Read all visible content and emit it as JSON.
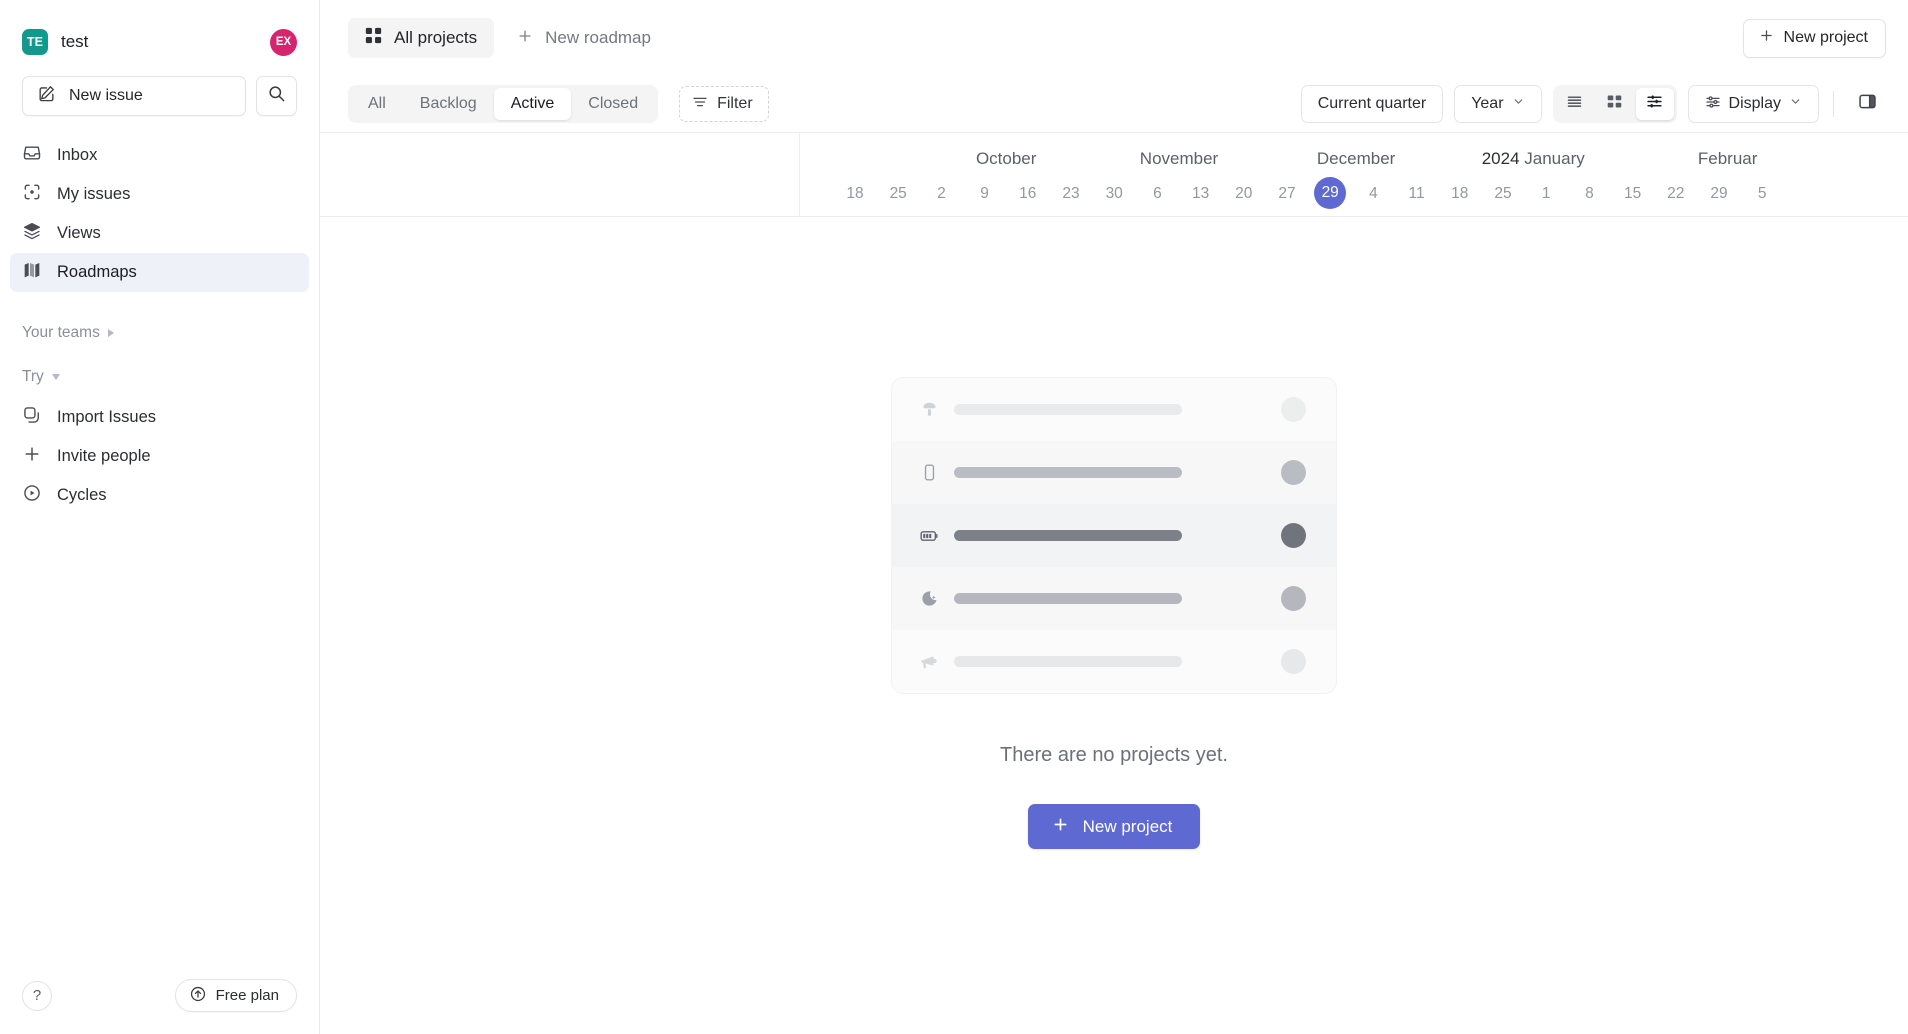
{
  "sidebar": {
    "workspace": {
      "badge": "TE",
      "name": "test",
      "avatar": "EX"
    },
    "new_issue": {
      "label": "New issue",
      "icon": "compose-icon"
    },
    "search": {
      "icon": "search-icon"
    },
    "nav": [
      {
        "label": "Inbox",
        "icon": "inbox-icon",
        "active": false
      },
      {
        "label": "My issues",
        "icon": "target-icon",
        "active": false
      },
      {
        "label": "Views",
        "icon": "layers-icon",
        "active": false
      },
      {
        "label": "Roadmaps",
        "icon": "roadmap-icon",
        "active": true
      }
    ],
    "your_teams": {
      "label": "Your teams",
      "expanded": false
    },
    "try": {
      "label": "Try",
      "expanded": true
    },
    "try_items": [
      {
        "label": "Import Issues",
        "icon": "copy-icon"
      },
      {
        "label": "Invite people",
        "icon": "plus-icon"
      },
      {
        "label": "Cycles",
        "icon": "play-circle-icon"
      }
    ],
    "footer": {
      "help": "?",
      "plan_label": "Free plan",
      "plan_icon": "arrow-up-circle-icon"
    }
  },
  "topbar": {
    "all_projects": {
      "label": "All projects",
      "icon": "grid-icon"
    },
    "new_roadmap": {
      "label": "New roadmap",
      "icon": "plus-icon"
    },
    "new_project": {
      "label": "New project",
      "icon": "plus-icon"
    }
  },
  "toolbar": {
    "status_tabs": [
      {
        "label": "All",
        "selected": false
      },
      {
        "label": "Backlog",
        "selected": false
      },
      {
        "label": "Active",
        "selected": true
      },
      {
        "label": "Closed",
        "selected": false
      }
    ],
    "filter": {
      "label": "Filter",
      "icon": "filter-icon"
    },
    "current_quarter": {
      "label": "Current quarter"
    },
    "zoom_select": {
      "label": "Year",
      "icon": "chevron-down-icon"
    },
    "view_modes": [
      {
        "name": "list-view",
        "icon": "list-icon",
        "selected": false
      },
      {
        "name": "grid-view",
        "icon": "grid-squares-icon",
        "selected": false
      },
      {
        "name": "timeline-view",
        "icon": "timeline-icon",
        "selected": true
      }
    ],
    "display": {
      "label": "Display",
      "icon": "sliders-icon",
      "chevron": "chevron-down-icon"
    },
    "panel_toggle": {
      "icon": "side-panel-icon"
    }
  },
  "timeline": {
    "months": [
      {
        "label": "October",
        "year": ""
      },
      {
        "label": "November",
        "year": ""
      },
      {
        "label": "December",
        "year": ""
      },
      {
        "label": "January",
        "year": "2024"
      },
      {
        "label": "Februar",
        "year": ""
      }
    ],
    "days": [
      "18",
      "25",
      "2",
      "9",
      "16",
      "23",
      "30",
      "6",
      "13",
      "20",
      "27",
      "29",
      "4",
      "11",
      "18",
      "25",
      "1",
      "8",
      "15",
      "22",
      "29",
      "5"
    ],
    "today": "29"
  },
  "empty_state": {
    "message": "There are no projects yet.",
    "cta_label": "New project",
    "cta_icon": "plus-icon",
    "cta_color": "#5E6AD2",
    "skeleton_rows": [
      {
        "icon": "mushroom-icon",
        "shade": "#e9eaec",
        "dot": "#eceded"
      },
      {
        "icon": "phone-icon",
        "shade": "#b9bcc2",
        "dot": "#b9bcc2"
      },
      {
        "icon": "battery-icon",
        "shade": "#7c8089",
        "dot": "#70747d"
      },
      {
        "icon": "moon-icon",
        "shade": "#b4b7bd",
        "dot": "#b4b7bd"
      },
      {
        "icon": "megaphone-icon",
        "shade": "#e7e8ea",
        "dot": "#e7e8ea"
      }
    ]
  }
}
